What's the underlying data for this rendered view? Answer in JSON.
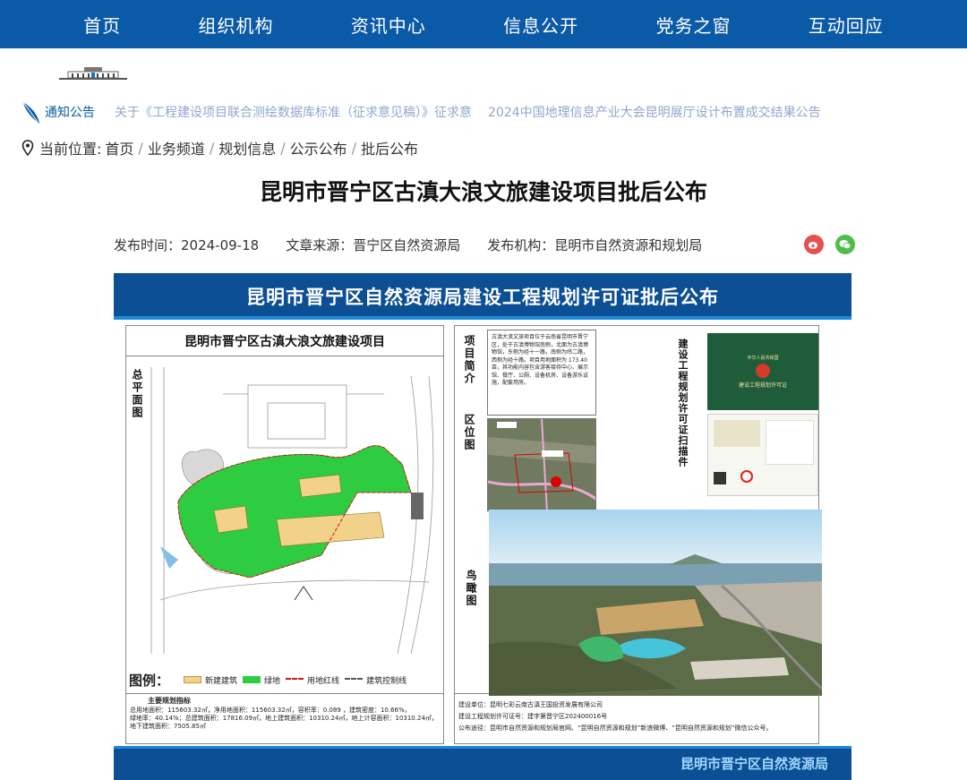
{
  "nav": {
    "items": [
      "首页",
      "组织机构",
      "资讯中心",
      "信息公开",
      "党务之窗",
      "互动回应"
    ]
  },
  "notice": {
    "label": "通知公告",
    "items": [
      "关于《工程建设项目联合测绘数据库标准（征求意见稿）》征求意",
      "2024中国地理信息产业大会昆明展厅设计布置成交结果公告"
    ]
  },
  "breadcrumb": {
    "prefix": "当前位置:",
    "items": [
      "首页",
      "业务频道",
      "规划信息",
      "公示公布",
      "批后公布"
    ]
  },
  "article": {
    "title": "昆明市晋宁区古滇大浪文旅建设项目批后公布",
    "publish_time": "发布时间：2024-09-18",
    "source": "文章来源：晋宁区自然资源局",
    "publisher": "发布机构：昆明市自然资源和规划局"
  },
  "poster": {
    "header": "昆明市晋宁区自然资源局建设工程规划许可证批后公布",
    "left_title": "昆明市晋宁区古滇大浪文旅建设项目",
    "site_plan_label": "总平面图",
    "legend": {
      "title": "图例：",
      "new_building": "新建建筑",
      "green": "绿地",
      "red_line": "用地红线",
      "control_line": "建筑控制线"
    },
    "stats_title": "主要规划指标",
    "stats": [
      "总用地面积：115603.32㎡，净用地面积：115603.32㎡，容积率：0.089 ，建筑密度：10.66%，",
      "绿地率：40.14%；总建筑面积：17816.09㎡，地上建筑面积：10310.24㎡，地上计容面积：10310.24㎡，",
      "地下建筑面积：7505.85㎡"
    ],
    "labels": {
      "intro": "项目简介",
      "location": "区位图",
      "aerial": "鸟瞰图",
      "scan": "建设工程规划许可证扫描件"
    },
    "intro_text": "古滇大浪文旅项目位于云南省昆明市晋宁区，处于古滇博物馆南侧，北面为古滇博物馆，东侧为经十一路，南侧为纬二路，西侧为经十路。项目用地面积为 173.40亩，其功能内容包含游客接待中心、展示馆、餐厅、公厕、设备机房、设备游乐设施，配套用房。",
    "cert": {
      "country": "中华人民共和国",
      "title": "建设工程规划许可证"
    },
    "info": [
      "建设单位：昆明七彩云南古滇王国投资发展有限公司",
      "建设工程规划许可证号：建字第晋宁区202400016号",
      "公布途径：昆明市自然资源和规划局官网、“昆明自然资源和规划”新浪微博、“昆明自然资源和规划”微信公众号。"
    ],
    "footer": "昆明市晋宁区自然资源局"
  },
  "colors": {
    "nav": "#0b5aa8",
    "poster_band": "#0d4f94",
    "green": "#2ecc40",
    "building": "#f2d28a"
  }
}
